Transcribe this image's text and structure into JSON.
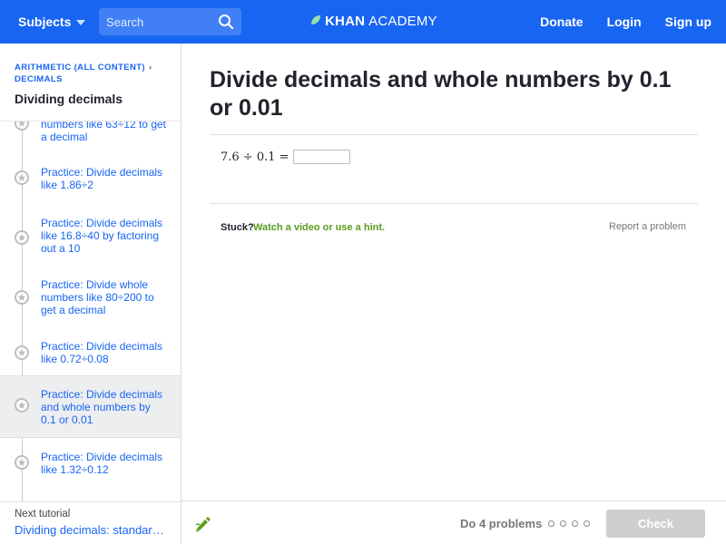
{
  "header": {
    "subjects_label": "Subjects",
    "search_placeholder": "Search",
    "logo_khan": "KHAN",
    "logo_academy": "ACADEMY",
    "donate": "Donate",
    "login": "Login",
    "signup": "Sign up",
    "bar_color": "#1865f2"
  },
  "sidebar": {
    "breadcrumb_line1": "ARITHMETIC (ALL CONTENT)",
    "breadcrumb_line2": "DECIMALS",
    "breadcrumb_sep": "›",
    "title": "Dividing decimals",
    "items": [
      {
        "label": "numbers like 63÷12 to get a decimal",
        "active": false
      },
      {
        "label": "Practice: Divide decimals like 1.86÷2",
        "active": false
      },
      {
        "label": "Practice: Divide decimals like 16.8÷40 by factoring out a 10",
        "active": false
      },
      {
        "label": "Practice: Divide whole numbers like 80÷200 to get a decimal",
        "active": false
      },
      {
        "label": "Practice: Divide decimals like 0.72÷0.08",
        "active": false
      },
      {
        "label": "Practice: Divide decimals and whole numbers by 0.1 or 0.01",
        "active": true
      },
      {
        "label": "Practice: Divide decimals like 1.32÷0.12",
        "active": false
      }
    ],
    "next_label": "Next tutorial",
    "next_link": "Dividing decimals: standard algorithm"
  },
  "main": {
    "title": "Divide decimals and whole numbers by 0.1 or 0.01",
    "problem": "7.6 ÷ 0.1 =",
    "answer_value": "",
    "stuck": "Stuck?",
    "hint_link": "Watch a video or use a hint.",
    "report": "Report a problem"
  },
  "footer": {
    "do_problems": "Do 4 problems",
    "check_label": "Check",
    "accent_green": "#5c9c1e"
  }
}
